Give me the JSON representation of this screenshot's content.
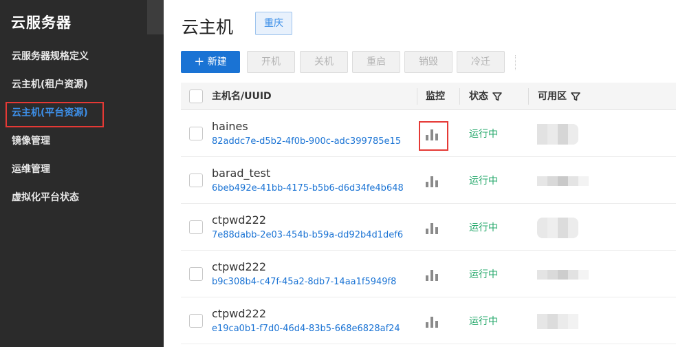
{
  "sidebar": {
    "title": "云服务器",
    "items": [
      {
        "label": "云服务器规格定义",
        "active": false
      },
      {
        "label": "云主机(租户资源)",
        "active": false
      },
      {
        "label": "云主机(平台资源)",
        "active": true
      },
      {
        "label": "镜像管理",
        "active": false
      },
      {
        "label": "运维管理",
        "active": false
      },
      {
        "label": "虚拟化平台状态",
        "active": false
      }
    ]
  },
  "header": {
    "title": "云主机",
    "region": "重庆"
  },
  "toolbar": {
    "new_label": "新建",
    "power_on_label": "开机",
    "power_off_label": "关机",
    "restart_label": "重启",
    "destroy_label": "销毁",
    "cold_migrate_label": "冷迁"
  },
  "table": {
    "columns": {
      "name": "主机名/UUID",
      "monitor": "监控",
      "status": "状态",
      "zone": "可用区"
    },
    "rows": [
      {
        "name": "haines",
        "uuid": "82addc7e-d5b2-4f0b-900c-adc399785e15",
        "status": "运行中"
      },
      {
        "name": "barad_test",
        "uuid": "6beb492e-41bb-4175-b5b6-d6d34fe4b648",
        "status": "运行中"
      },
      {
        "name": "ctpwd222",
        "uuid": "7e88dabb-2e03-454b-b59a-dd92b4d1def6",
        "status": "运行中"
      },
      {
        "name": "ctpwd222",
        "uuid": "b9c308b4-c47f-45a2-8db7-14aa1f5949f8",
        "status": "运行中"
      },
      {
        "name": "ctpwd222",
        "uuid": "e19ca0b1-f7d0-46d4-83b5-668e6828af24",
        "status": "运行中"
      }
    ]
  },
  "colors": {
    "sidebar_bg": "#2b2b2b",
    "accent": "#1a73d4",
    "running": "#25a86b",
    "highlight": "#e53935"
  }
}
